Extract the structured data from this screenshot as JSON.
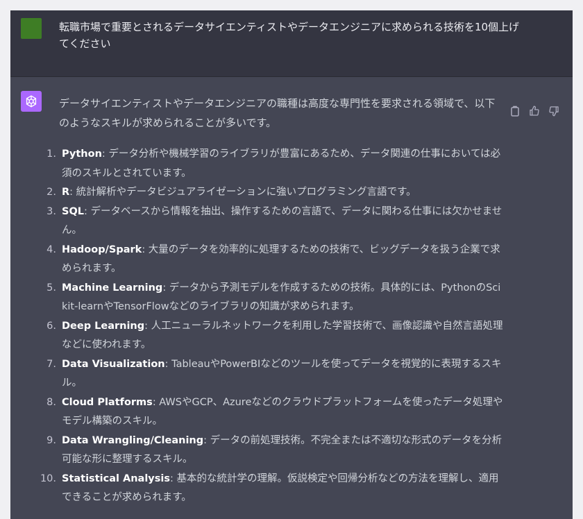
{
  "user": {
    "prompt": "転職市場で重要とされるデータサイエンティストやデータエンジニアに求められる技術を10個上げてください"
  },
  "assistant": {
    "intro": "データサイエンティストやデータエンジニアの職種は高度な専門性を要求される領域で、以下のようなスキルが求められることが多いです。",
    "items": [
      {
        "num": "1.",
        "term": "Python",
        "desc": ": データ分析や機械学習のライブラリが豊富にあるため、データ関連の仕事においては必須のスキルとされています。"
      },
      {
        "num": "2.",
        "term": "R",
        "desc": ": 統計解析やデータビジュアライゼーションに強いプログラミング言語です。"
      },
      {
        "num": "3.",
        "term": "SQL",
        "desc": ": データベースから情報を抽出、操作するための言語で、データに関わる仕事には欠かせません。"
      },
      {
        "num": "4.",
        "term": "Hadoop/Spark",
        "desc": ": 大量のデータを効率的に処理するための技術で、ビッグデータを扱う企業で求められます。"
      },
      {
        "num": "5.",
        "term": "Machine Learning",
        "desc": ": データから予測モデルを作成するための技術。具体的には、PythonのScikit-learnやTensorFlowなどのライブラリの知識が求められます。"
      },
      {
        "num": "6.",
        "term": "Deep Learning",
        "desc": ": 人工ニューラルネットワークを利用した学習技術で、画像認識や自然言語処理などに使われます。"
      },
      {
        "num": "7.",
        "term": "Data Visualization",
        "desc": ": TableauやPowerBIなどのツールを使ってデータを視覚的に表現するスキル。"
      },
      {
        "num": "8.",
        "term": "Cloud Platforms",
        "desc": ": AWSやGCP、Azureなどのクラウドプラットフォームを使ったデータ処理やモデル構築のスキル。"
      },
      {
        "num": "9.",
        "term": "Data Wrangling/Cleaning",
        "desc": ": データの前処理技術。不完全または不適切な形式のデータを分析可能な形に整理するスキル。"
      },
      {
        "num": "10.",
        "term": "Statistical Analysis",
        "desc": ": 基本的な統計学の理解。仮説検定や回帰分析などの方法を理解し、適用できることが求められます。"
      }
    ]
  },
  "icons": {
    "user_avatar_color": "#3e7d25",
    "bot_avatar_color": "#ab68ff",
    "actions": [
      "copy-icon",
      "thumbs-up-icon",
      "thumbs-down-icon"
    ]
  }
}
